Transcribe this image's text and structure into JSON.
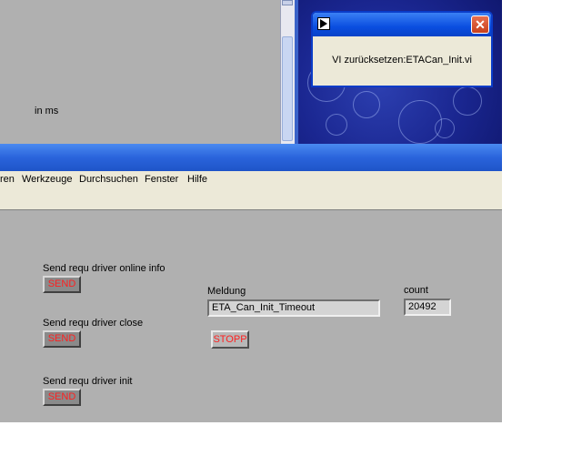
{
  "background_window": {
    "label_unit": "in ms"
  },
  "dialog": {
    "message": "VI zurücksetzen:ETACan_Init.vi"
  },
  "menu": {
    "items": [
      {
        "label": "ren"
      },
      {
        "label": "Werkzeuge"
      },
      {
        "label": "Durchsuchen"
      },
      {
        "label": "Fenster"
      },
      {
        "label": "Hilfe"
      }
    ]
  },
  "panel": {
    "online_info": {
      "label": "Send requ driver online info",
      "button": "SEND"
    },
    "close": {
      "label": "Send requ driver close",
      "button": "SEND"
    },
    "init": {
      "label": "Send requ driver init",
      "button": "SEND"
    },
    "meldung": {
      "label": "Meldung",
      "value": "ETA_Can_Init_Timeout"
    },
    "count": {
      "label": "count",
      "value": "20492"
    },
    "stop_button": "STOPP"
  },
  "colors": {
    "titlebar": "#2a64dc",
    "panel_bg": "#b0b0b0",
    "button_text": "#ff2020"
  }
}
